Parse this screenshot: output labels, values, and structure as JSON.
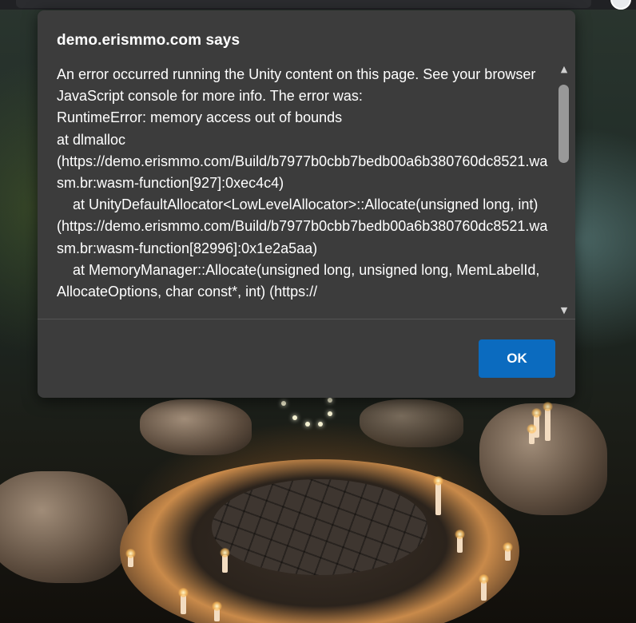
{
  "dialog": {
    "title": "demo.erismmo.com says",
    "message": "An error occurred running the Unity content on this page. See your browser JavaScript console for more info. The error was:\nRuntimeError: memory access out of bounds\nat dlmalloc (https://demo.erismmo.com/Build/b7977b0cbb7bedb00a6b380760dc8521.wasm.br:wasm-function[927]:0xec4c4)\n    at UnityDefaultAllocator<LowLevelAllocator>::Allocate(unsigned long, int) (https://demo.erismmo.com/Build/b7977b0cbb7bedb00a6b380760dc8521.wasm.br:wasm-function[82996]:0x1e2a5aa)\n    at MemoryManager::Allocate(unsigned long, unsigned long, MemLabelId, AllocateOptions, char const*, int) (https://",
    "ok_label": "OK",
    "scroll_up_icon": "chevron-up-icon",
    "scroll_down_icon": "chevron-down-icon",
    "accent_color": "#0b6bbf"
  },
  "background": {
    "description_icon": "game-scene"
  }
}
